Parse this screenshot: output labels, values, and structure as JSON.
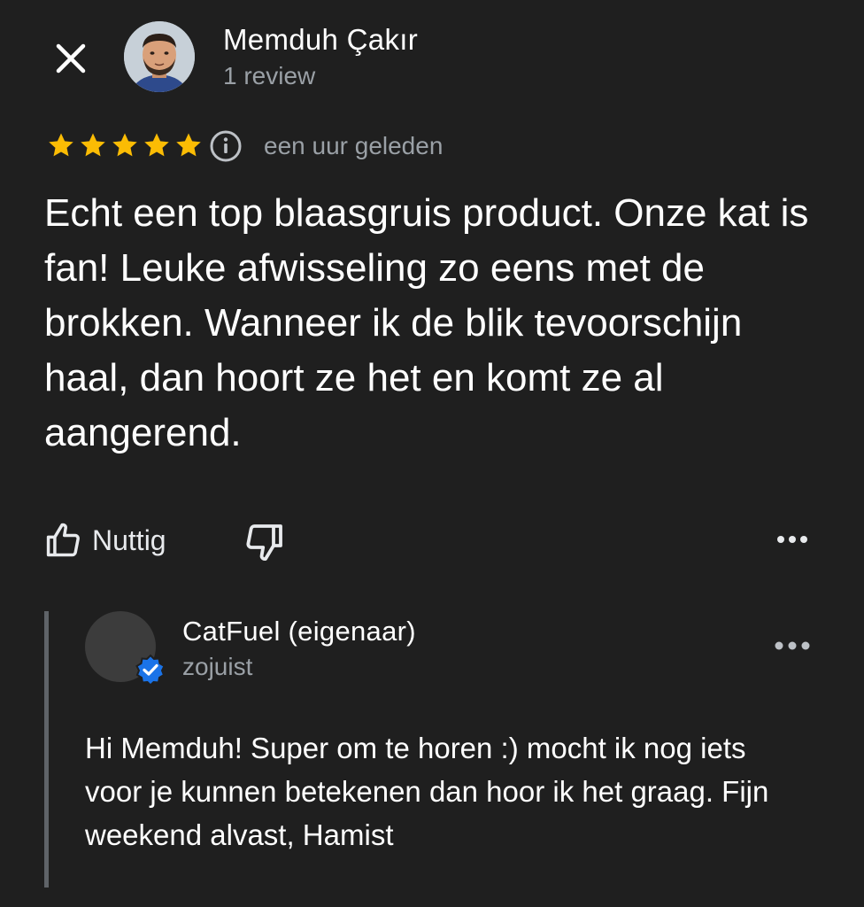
{
  "review": {
    "author_name": "Memduh Çakır",
    "author_review_count": "1 review",
    "rating": 5,
    "max_rating": 5,
    "time": "een uur geleden",
    "text": "Echt een top blaasgruis product. Onze kat is fan! Leuke afwisseling zo eens met de brokken. Wanneer ik de blik tevoorschijn haal, dan hoort ze het en komt ze al aangerend.",
    "helpful_label": "Nuttig",
    "star_color": "#fbbc04"
  },
  "reply": {
    "owner_name": "CatFuel (eigenaar)",
    "time": "zojuist",
    "text": "Hi Memduh! Super om te horen :) mocht ik nog iets voor je kunnen betekenen dan hoor ik het graag. Fijn weekend alvast, Hamist",
    "badge_color": "#1a73e8"
  },
  "icons": {
    "close": "close-icon",
    "info": "info-icon",
    "thumbs_up": "thumbs-up-icon",
    "thumbs_down": "thumbs-down-icon",
    "more": "more-horizontal-icon",
    "verified": "verified-badge-icon"
  }
}
